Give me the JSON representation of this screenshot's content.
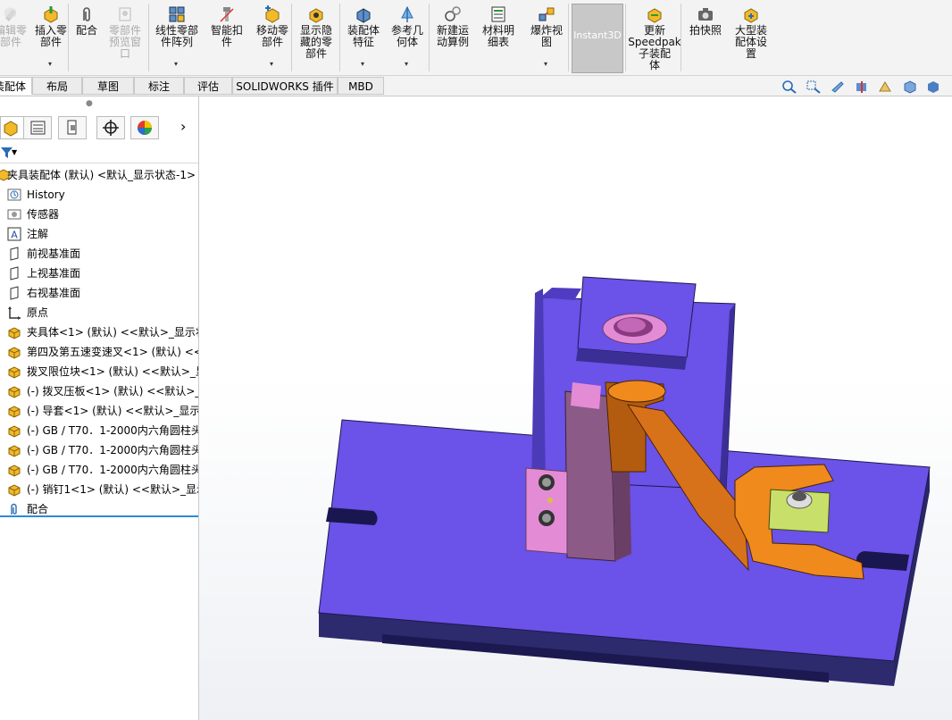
{
  "ribbon": {
    "buttons": [
      {
        "id": "edit-part",
        "label": "编辑零\n部件",
        "icon": "edit-component-icon",
        "disabled": true
      },
      {
        "id": "insert-part",
        "label": "插入零\n部件",
        "icon": "insert-component-icon",
        "dropdown": true
      },
      {
        "id": "mate",
        "label": "配合",
        "icon": "paperclip-mate-icon"
      },
      {
        "id": "part-preview",
        "label": "零部件\n预览窗\n口",
        "icon": "preview-window-icon",
        "disabled": true
      },
      {
        "id": "linear-pattern",
        "label": "线性零部\n件阵列",
        "icon": "linear-pattern-icon",
        "dropdown": true
      },
      {
        "id": "smart-fasteners",
        "label": "智能扣\n件",
        "icon": "smart-fastener-icon"
      },
      {
        "id": "move-component",
        "label": "移动零\n部件",
        "icon": "move-component-icon",
        "dropdown": true
      },
      {
        "id": "show-hidden",
        "label": "显示隐\n藏的零\n部件",
        "icon": "show-hidden-icon"
      },
      {
        "id": "assembly-feature",
        "label": "装配体\n特征",
        "icon": "assembly-feature-icon",
        "dropdown": true
      },
      {
        "id": "reference-geometry",
        "label": "参考几\n何体",
        "icon": "reference-geometry-icon",
        "dropdown": true
      },
      {
        "id": "new-motion",
        "label": "新建运\n动算例",
        "icon": "motion-study-icon"
      },
      {
        "id": "bom",
        "label": "材料明\n细表",
        "icon": "bom-icon"
      },
      {
        "id": "exploded-view",
        "label": "爆炸视\n图",
        "icon": "exploded-view-icon",
        "dropdown": true
      },
      {
        "id": "instant3d",
        "label": "Instant3D",
        "icon": "instant3d-icon",
        "active": true
      },
      {
        "id": "update-speedpak",
        "label": "更新\nSpeedpak\n子装配\n体",
        "icon": "speedpak-icon"
      },
      {
        "id": "snapshot",
        "label": "拍快照",
        "icon": "camera-icon"
      },
      {
        "id": "large-assembly",
        "label": "大型装\n配体设\n置",
        "icon": "large-assembly-icon"
      }
    ]
  },
  "tabs": [
    "装配体",
    "布局",
    "草图",
    "标注",
    "评估",
    "SOLIDWORKS 插件",
    "MBD"
  ],
  "active_tab": 0,
  "feature_tree": {
    "root": "夹具装配体 (默认) <默认_显示状态-1>",
    "items": [
      {
        "label": "History",
        "icon": "history-icon"
      },
      {
        "label": "传感器",
        "icon": "sensor-icon"
      },
      {
        "label": "注解",
        "icon": "annotation-icon"
      },
      {
        "label": "前视基准面",
        "icon": "plane-icon"
      },
      {
        "label": "上视基准面",
        "icon": "plane-icon"
      },
      {
        "label": "右视基准面",
        "icon": "plane-icon"
      },
      {
        "label": "原点",
        "icon": "origin-icon"
      },
      {
        "label": "夹具体<1> (默认) <<默认>_显示状",
        "icon": "part-icon"
      },
      {
        "label": "第四及第五速变速叉<1> (默认) <<",
        "icon": "part-icon"
      },
      {
        "label": "拨叉限位块<1> (默认) <<默认>_显",
        "icon": "part-icon"
      },
      {
        "label": "(-) 拨叉压板<1> (默认) <<默认>_",
        "icon": "part-icon"
      },
      {
        "label": "(-) 导套<1> (默认) <<默认>_显示",
        "icon": "part-icon"
      },
      {
        "label": "(-) GB / T70．1-2000内六角圆柱头",
        "icon": "part-icon"
      },
      {
        "label": "(-) GB / T70．1-2000内六角圆柱头",
        "icon": "part-icon"
      },
      {
        "label": "(-) GB / T70．1-2000内六角圆柱头",
        "icon": "part-icon"
      },
      {
        "label": "(-) 销钉1<1> (默认) <<默认>_显示",
        "icon": "part-icon"
      },
      {
        "label": "配合",
        "icon": "mates-icon"
      }
    ]
  },
  "colors": {
    "base": "#6b52e8",
    "base_dark": "#2e2a6e",
    "fork": "#f08a1c",
    "pink": "#e48bd6",
    "mauve": "#8c5a86",
    "yellow_green": "#c8e06a"
  }
}
